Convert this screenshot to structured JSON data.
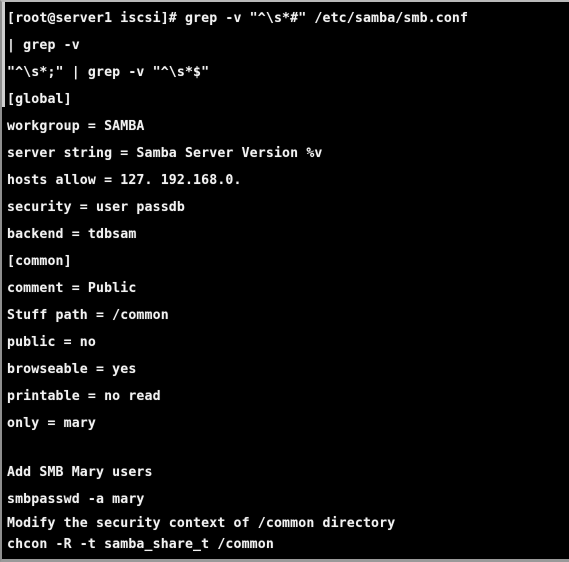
{
  "window": {
    "title": "Terminal",
    "background_color": "#000000",
    "text_color": "#f2f2f2",
    "border_color": "#9a9a9a"
  },
  "terminal": {
    "prompt": "[root@server1 iscsi]#",
    "user": "root",
    "host": "server1",
    "cwd": "iscsi",
    "prompt_symbol": "#",
    "lines": [
      {
        "text": "[root@server1 iscsi]# grep -v \"^\\s*#\" /etc/samba/smb.conf",
        "kind": "command",
        "clipped": true
      },
      {
        "text": "| grep -v",
        "kind": "command"
      },
      {
        "text": "\"^\\s*;\" | grep -v \"^\\s*$\"",
        "kind": "command"
      },
      {
        "text": "[global]",
        "kind": "output"
      },
      {
        "text": "workgroup = SAMBA",
        "kind": "output"
      },
      {
        "text": "server string = Samba Server Version %v",
        "kind": "output"
      },
      {
        "text": "hosts allow = 127. 192.168.0.",
        "kind": "output"
      },
      {
        "text": "security = user passdb",
        "kind": "output"
      },
      {
        "text": "backend = tdbsam",
        "kind": "output"
      },
      {
        "text": "[common]",
        "kind": "output"
      },
      {
        "text": "comment = Public",
        "kind": "output"
      },
      {
        "text": "Stuff path = /common",
        "kind": "output"
      },
      {
        "text": "public = no",
        "kind": "output"
      },
      {
        "text": "browseable = yes",
        "kind": "output"
      },
      {
        "text": "printable = no read",
        "kind": "output"
      },
      {
        "text": "only = mary",
        "kind": "output"
      },
      {
        "text": "",
        "kind": "blank"
      },
      {
        "text": "Add SMB Mary users",
        "kind": "note"
      },
      {
        "text": "smbpasswd -a mary",
        "kind": "command"
      },
      {
        "text": "Modify the security context of /common directory",
        "kind": "note",
        "tight": true
      },
      {
        "text": "chcon -R -t samba_share_t /common",
        "kind": "command",
        "tight": true
      }
    ]
  }
}
